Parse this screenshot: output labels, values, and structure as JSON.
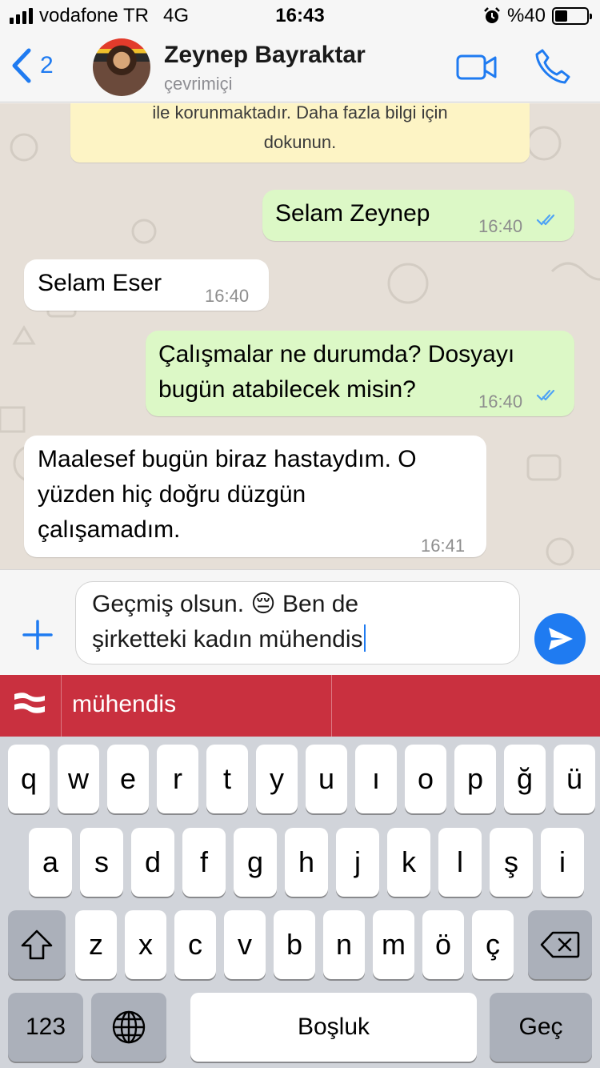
{
  "status_bar": {
    "carrier": "vodafone TR",
    "network": "4G",
    "time": "16:43",
    "battery": "%40",
    "battery_level": 0.4,
    "icons": [
      "signal-icon",
      "alarm-icon",
      "battery-icon"
    ]
  },
  "header": {
    "back_count": "2",
    "name": "Zeynep Bayraktar",
    "status": "çevrimiçi",
    "icons": [
      "back-chevron-icon",
      "video-call-icon",
      "phone-icon"
    ]
  },
  "chat": {
    "notice_lines": [
      "ile korunmaktadır. Daha fazla bilgi için",
      "dokunun."
    ],
    "messages": [
      {
        "direction": "out",
        "lines": [
          "Selam Zeynep"
        ],
        "time": "16:40",
        "read": true
      },
      {
        "direction": "in",
        "lines": [
          "Selam Eser"
        ],
        "time": "16:40"
      },
      {
        "direction": "out",
        "lines": [
          "Çalışmalar ne durumda? Dosyayı",
          "bugün atabilecek misin?"
        ],
        "time": "16:40",
        "read": true
      },
      {
        "direction": "in",
        "lines": [
          "Maalesef bugün biraz hastaydım. O",
          "yüzden hiç doğru düzgün",
          "çalışamadım."
        ],
        "time": "16:41"
      }
    ],
    "colors": {
      "outgoing": "#dcf8c6",
      "incoming": "#ffffff",
      "read_ticks": "#4fa3f5",
      "background": "#e6dfd7"
    }
  },
  "composer": {
    "line1": "Geçmiş olsun. 😔 Ben de",
    "line2": "şirketteki kadın mühendis",
    "icons": [
      "plus-icon",
      "send-icon"
    ]
  },
  "suggestion_bar": {
    "word": "mühendis",
    "color": "#c9303f",
    "icons": [
      "flag-icon"
    ]
  },
  "keyboard": {
    "row1": [
      "q",
      "w",
      "e",
      "r",
      "t",
      "y",
      "u",
      "ı",
      "o",
      "p",
      "ğ",
      "ü"
    ],
    "row2": [
      "a",
      "s",
      "d",
      "f",
      "g",
      "h",
      "j",
      "k",
      "l",
      "ş",
      "i"
    ],
    "row3": [
      "z",
      "x",
      "c",
      "v",
      "b",
      "n",
      "m",
      "ö",
      "ç"
    ],
    "numbers_label": "123",
    "space_label": "Boşluk",
    "return_label": "Geç",
    "icons": [
      "shift-icon",
      "backspace-icon",
      "globe-icon"
    ]
  }
}
